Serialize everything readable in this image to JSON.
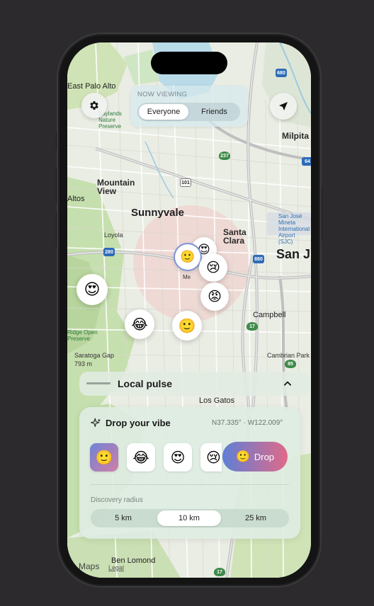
{
  "map": {
    "places": [
      {
        "name": "East Palo Alto"
      },
      {
        "name": "Mountain View"
      },
      {
        "name": "Sunnyvale"
      },
      {
        "name": "Santa Clara"
      },
      {
        "name": "San J"
      },
      {
        "name": "Milpita"
      },
      {
        "name": "Campbell"
      },
      {
        "name": "Los Gatos"
      },
      {
        "name": "Altos"
      },
      {
        "name": "Loyola"
      },
      {
        "name": "Cambrian Park"
      },
      {
        "name": "Ben Lomond"
      },
      {
        "name": "San José Mineta International Airport (SJC)"
      },
      {
        "name": "Saratoga Gap 793 m"
      },
      {
        "name": "Ridge Open Preserve"
      },
      {
        "name": "Baylands Nature Preserve"
      }
    ],
    "highways": [
      "680",
      "237",
      "101",
      "280",
      "880",
      "17",
      "85",
      "64"
    ],
    "attribution": "Maps",
    "legal": "Legal",
    "me_label": "Me"
  },
  "header": {
    "now_viewing": "NOW VIEWING",
    "segments": [
      "Everyone",
      "Friends"
    ],
    "selected_segment": "Everyone"
  },
  "icons": {
    "settings": "gear-icon",
    "locate": "location-arrow-icon",
    "sparkle": "sparkle-icon",
    "chevron": "chevron-up-icon"
  },
  "bubbles": [
    {
      "emoji": "😍",
      "id": "heart-eyes"
    },
    {
      "emoji": "😂",
      "id": "tears-of-joy"
    },
    {
      "emoji": "🙂",
      "id": "smile"
    },
    {
      "emoji": "🙂",
      "id": "me"
    },
    {
      "emoji": "😢",
      "id": "crying"
    },
    {
      "emoji": "😡",
      "id": "angry"
    }
  ],
  "pulse": {
    "title": "Local pulse"
  },
  "drop": {
    "title": "Drop your vibe",
    "coords": "N37.335° · W122.009°",
    "moods": [
      "🙂",
      "😂",
      "😍",
      "😢"
    ],
    "selected_mood": "🙂",
    "button_label": "Drop",
    "button_emoji": "🙂",
    "radius_label": "Discovery radius",
    "radius_options": [
      "5 km",
      "10 km",
      "25 km"
    ],
    "selected_radius": "10 km"
  },
  "colors": {
    "accent_start": "#5e7fd6",
    "accent_end": "#e06a88",
    "pulse_zone": "#f3c9c6"
  }
}
